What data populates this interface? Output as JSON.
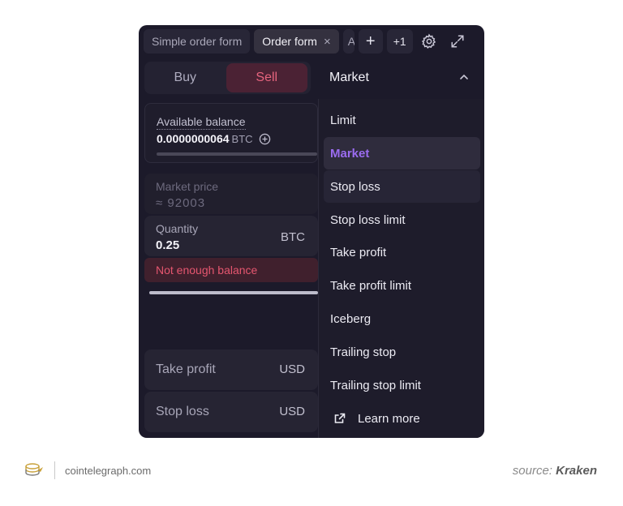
{
  "tabs": [
    {
      "label": "Simple order form",
      "active": false
    },
    {
      "label": "Order form",
      "active": true,
      "close": "×"
    }
  ],
  "tab_cut_label": "A",
  "toolbar": {
    "add_label": "+",
    "more_label": "+1"
  },
  "side": {
    "buy_label": "Buy",
    "sell_label": "Sell",
    "selected": "Sell"
  },
  "balance": {
    "label": "Available balance",
    "value": "0.0000000064",
    "unit": "BTC"
  },
  "market_price": {
    "label": "Market price",
    "value": "≈ 92003"
  },
  "quantity": {
    "label": "Quantity",
    "value": "0.25",
    "unit": "BTC"
  },
  "error": "Not enough balance",
  "take_profit": {
    "label": "Take profit",
    "unit": "USD"
  },
  "stop_loss": {
    "label": "Stop loss",
    "unit": "USD"
  },
  "order_type": {
    "selected": "Market",
    "options": [
      "Limit",
      "Market",
      "Stop loss",
      "Stop loss limit",
      "Take profit",
      "Take profit limit",
      "Iceberg",
      "Trailing stop",
      "Trailing stop limit"
    ],
    "learn_more": "Learn more"
  },
  "footer": {
    "site": "cointelegraph.com",
    "source_prefix": "source:",
    "source_name": "Kraken"
  },
  "colors": {
    "panel_bg": "#1c1a2a",
    "sell_accent": "#e6647e",
    "selected_accent": "#9b6cf0",
    "error": "#e5566f"
  }
}
